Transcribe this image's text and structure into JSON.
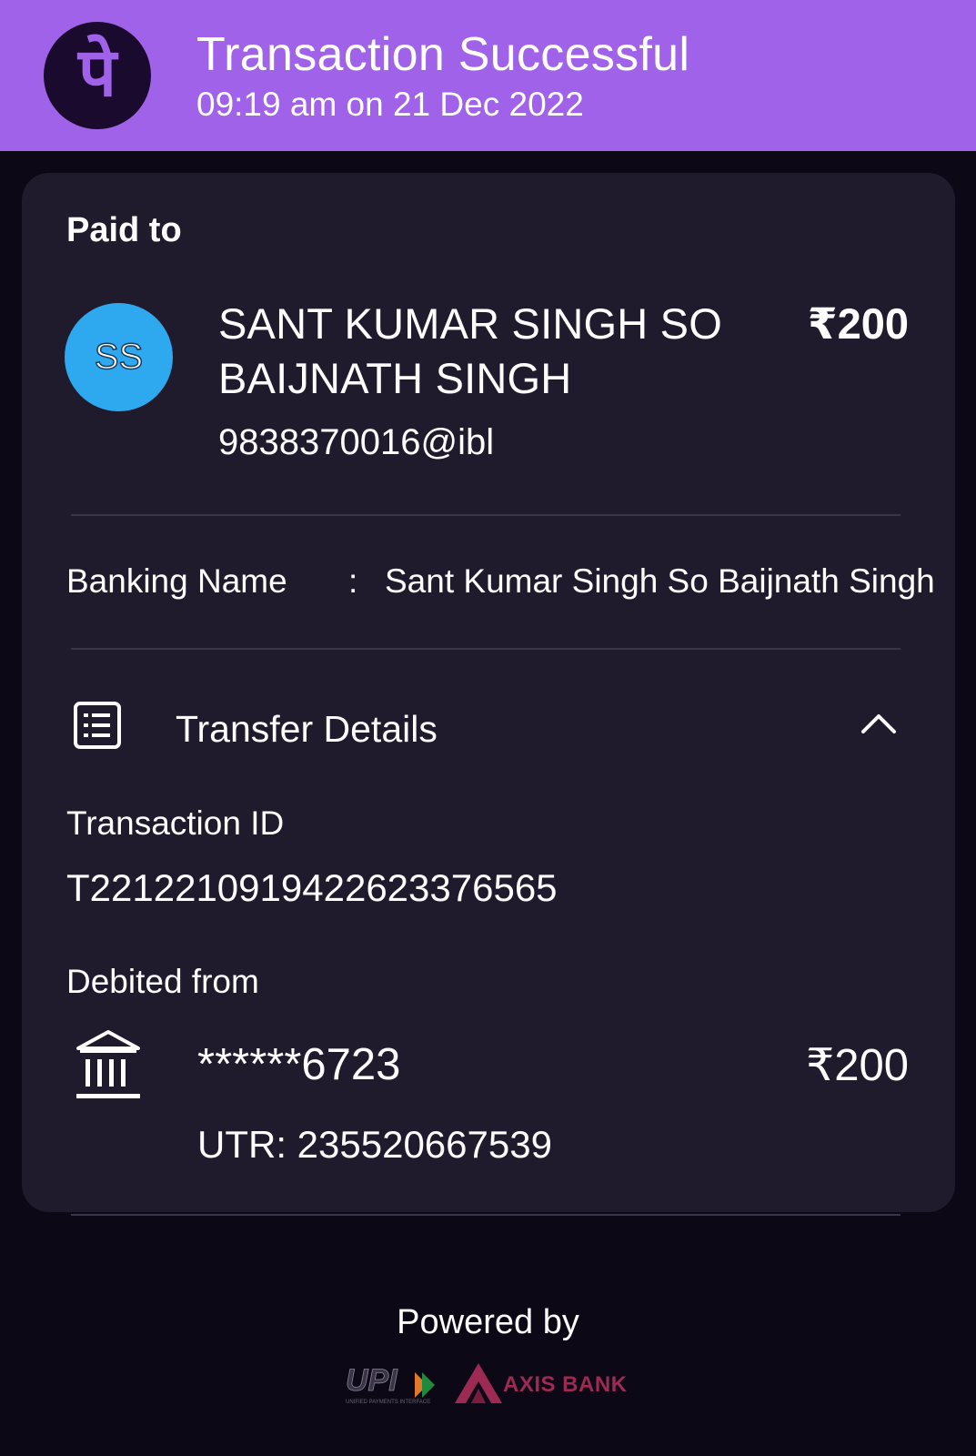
{
  "header": {
    "logo_glyph": "पे",
    "title": "Transaction Successful",
    "subtitle": "09:19 am on 21 Dec 2022"
  },
  "payee": {
    "section_label": "Paid to",
    "avatar_initials": "SS",
    "name": "SANT KUMAR SINGH SO BAIJNATH SINGH",
    "amount": "₹200",
    "upi_id": "9838370016@ibl"
  },
  "banking": {
    "label": "Banking Name",
    "separator": ":",
    "value": "Sant Kumar Singh So Baijnath Singh"
  },
  "transfer_details": {
    "title": "Transfer Details",
    "transaction_id_label": "Transaction ID",
    "transaction_id": "T2212210919422623376565",
    "debited_from_label": "Debited from",
    "account_masked": "******6723",
    "debit_amount": "₹200",
    "utr": "UTR: 235520667539"
  },
  "footer": {
    "powered_by": "Powered by",
    "upi_text": "UPI",
    "upi_tagline": "UNIFIED PAYMENTS INTERFACE",
    "bank_name": "AXIS BANK"
  },
  "colors": {
    "header_bg": "#a062e8",
    "page_bg": "#0c0816",
    "card_bg": "#201b2c",
    "avatar_bg": "#2ea8ee",
    "axis_brand": "#9c2a52"
  },
  "icons": {
    "logo": "phonepe-logo-icon",
    "transfer": "receipt-list-icon",
    "collapse": "chevron-up-icon",
    "bank": "bank-building-icon"
  }
}
